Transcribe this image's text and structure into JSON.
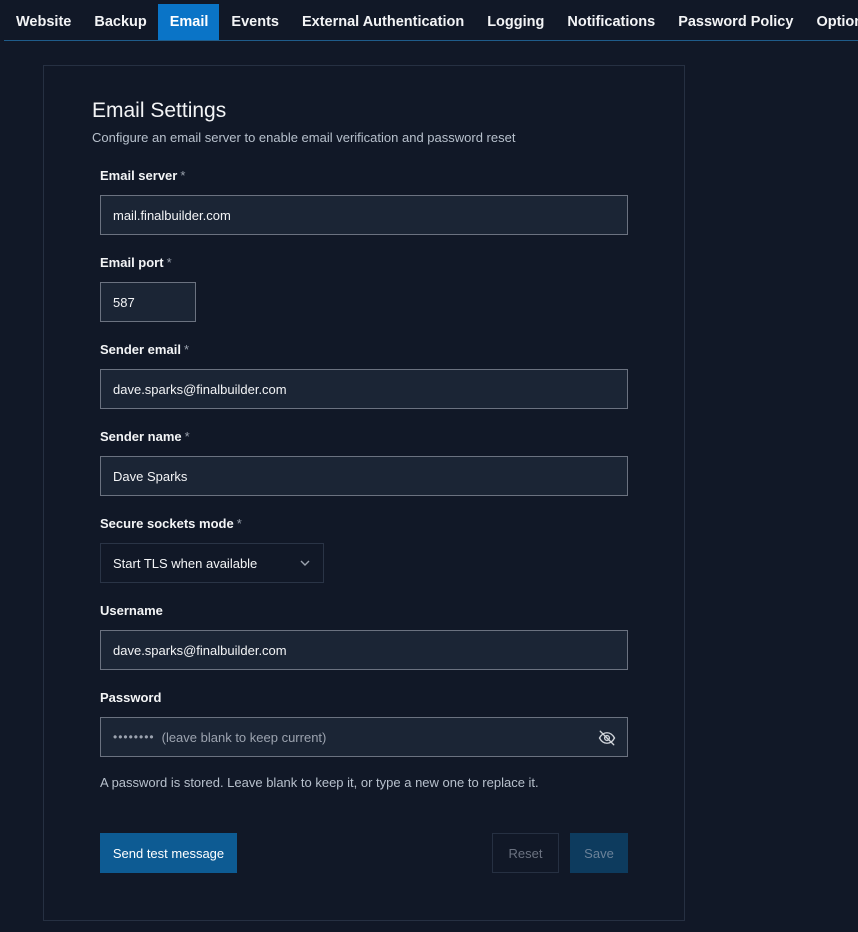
{
  "tabs": [
    {
      "label": "Website",
      "active": false
    },
    {
      "label": "Backup",
      "active": false
    },
    {
      "label": "Email",
      "active": true
    },
    {
      "label": "Events",
      "active": false
    },
    {
      "label": "External Authentication",
      "active": false
    },
    {
      "label": "Logging",
      "active": false
    },
    {
      "label": "Notifications",
      "active": false
    },
    {
      "label": "Password Policy",
      "active": false
    },
    {
      "label": "Options",
      "active": false
    }
  ],
  "page": {
    "title": "Email Settings",
    "subtitle": "Configure an email server to enable email verification and password reset"
  },
  "form": {
    "required_marker": "*",
    "email_server": {
      "label": "Email server",
      "value": "mail.finalbuilder.com"
    },
    "email_port": {
      "label": "Email port",
      "value": "587"
    },
    "sender_email": {
      "label": "Sender email",
      "value": "dave.sparks@finalbuilder.com"
    },
    "sender_name": {
      "label": "Sender name",
      "value": "Dave Sparks"
    },
    "secure_sockets": {
      "label": "Secure sockets mode",
      "value": "Start TLS when available"
    },
    "username": {
      "label": "Username",
      "value": "dave.sparks@finalbuilder.com"
    },
    "password": {
      "label": "Password",
      "masked": "••••••••",
      "placeholder": "(leave blank to keep current)",
      "hint": "A password is stored. Leave blank to keep it, or type a new one to replace it."
    }
  },
  "buttons": {
    "send_test": "Send test message",
    "reset": "Reset",
    "save": "Save"
  },
  "icons": {
    "password_toggle": "eye-off-icon",
    "select_caret": "chevron-down-icon"
  },
  "colors": {
    "accent": "#0a74c7",
    "background": "#111827",
    "field_bg": "#1b2535"
  }
}
